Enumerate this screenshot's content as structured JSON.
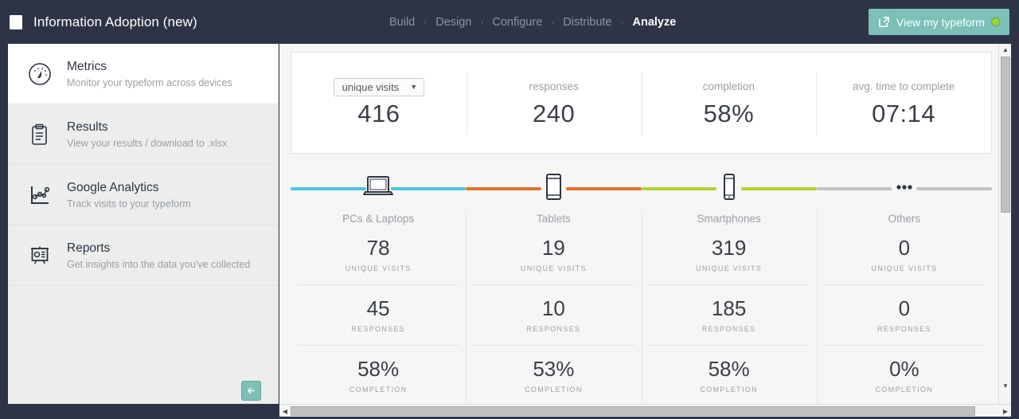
{
  "header": {
    "form_icon": "form-icon",
    "app_title": "Information Adoption (new)",
    "breadcrumb": [
      {
        "label": "Build",
        "active": false
      },
      {
        "label": "Design",
        "active": false
      },
      {
        "label": "Configure",
        "active": false
      },
      {
        "label": "Distribute",
        "active": false
      },
      {
        "label": "Analyze",
        "active": true
      }
    ],
    "separator": "›",
    "view_button": {
      "label": "View my typeform",
      "icon": "external-link-icon",
      "status_dot": "online-status-dot",
      "bg_color": "#7cc0b8",
      "dot_color": "#9ad63a"
    },
    "bg_color": "#2e3446"
  },
  "sidebar": {
    "items": [
      {
        "icon": "speedometer-icon",
        "title": "Metrics",
        "subtitle": "Monitor your typeform across devices",
        "active": true
      },
      {
        "icon": "clipboard-icon",
        "title": "Results",
        "subtitle": "View your results / download to .xlsx",
        "active": false
      },
      {
        "icon": "scatter-chart-icon",
        "title": "Google Analytics",
        "subtitle": "Track visits to your typeform",
        "active": false
      },
      {
        "icon": "presentation-board-icon",
        "title": "Reports",
        "subtitle": "Get insights into the data you've collected",
        "active": false
      }
    ],
    "collapse_button": {
      "icon": "arrow-left-icon",
      "color": "#7cc0b8"
    }
  },
  "main": {
    "summary": [
      {
        "label": "unique visits",
        "is_select": true,
        "value": "416"
      },
      {
        "label": "responses",
        "is_select": false,
        "value": "240"
      },
      {
        "label": "completion",
        "is_select": false,
        "value": "58%"
      },
      {
        "label": "avg. time to complete",
        "is_select": false,
        "value": "07:14"
      }
    ],
    "select_caret": "▼",
    "captions": {
      "unique_visits": "UNIQUE VISITS",
      "responses": "RESPONSES",
      "completion": "COMPLETION"
    },
    "devices": [
      {
        "name": "PCs & Laptops",
        "icon": "laptop-icon",
        "color": "#4ec5de",
        "unique_visits": "78",
        "responses": "45",
        "completion": "58%"
      },
      {
        "name": "Tablets",
        "icon": "tablet-icon",
        "color": "#e4722c",
        "unique_visits": "19",
        "responses": "10",
        "completion": "53%"
      },
      {
        "name": "Smartphones",
        "icon": "smartphone-icon",
        "color": "#b5d334",
        "unique_visits": "319",
        "responses": "185",
        "completion": "58%"
      },
      {
        "name": "Others",
        "icon": "ellipsis-icon",
        "color": "#c3c3c3",
        "unique_visits": "0",
        "responses": "0",
        "completion": "0%"
      }
    ]
  },
  "scrollbars": {
    "vertical": {
      "up": "▲",
      "down": "▼"
    },
    "horizontal": {
      "left": "◀",
      "right": "▶"
    }
  },
  "chart_data": {
    "type": "table",
    "title": "Typeform metrics by device",
    "categories": [
      "PCs & Laptops",
      "Tablets",
      "Smartphones",
      "Others"
    ],
    "series": [
      {
        "name": "unique visits",
        "values": [
          78,
          19,
          319,
          0
        ]
      },
      {
        "name": "responses",
        "values": [
          45,
          10,
          185,
          0
        ]
      },
      {
        "name": "completion",
        "values": [
          58,
          53,
          58,
          0
        ],
        "unit": "%"
      }
    ],
    "totals": {
      "unique_visits": 416,
      "responses": 240,
      "completion_pct": 58,
      "avg_time_to_complete": "07:14"
    },
    "colors": [
      "#4ec5de",
      "#e4722c",
      "#b5d334",
      "#c3c3c3"
    ]
  }
}
